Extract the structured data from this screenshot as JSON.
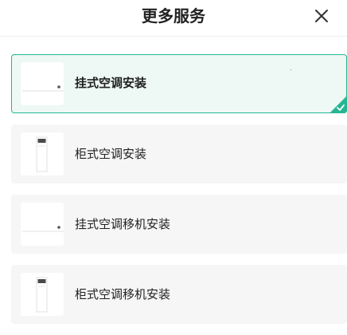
{
  "header": {
    "title": "更多服务"
  },
  "services": [
    {
      "label": "挂式空调安装",
      "icon": "wall-ac-icon",
      "selected": true
    },
    {
      "label": "柜式空调安装",
      "icon": "floor-ac-icon",
      "selected": false
    },
    {
      "label": "挂式空调移机安装",
      "icon": "wall-ac-icon",
      "selected": false
    },
    {
      "label": "柜式空调移机安装",
      "icon": "floor-ac-icon",
      "selected": false
    }
  ],
  "colors": {
    "accent": "#25b692",
    "selected_bg": "#eef8f5",
    "item_bg": "#f6f6f6"
  }
}
